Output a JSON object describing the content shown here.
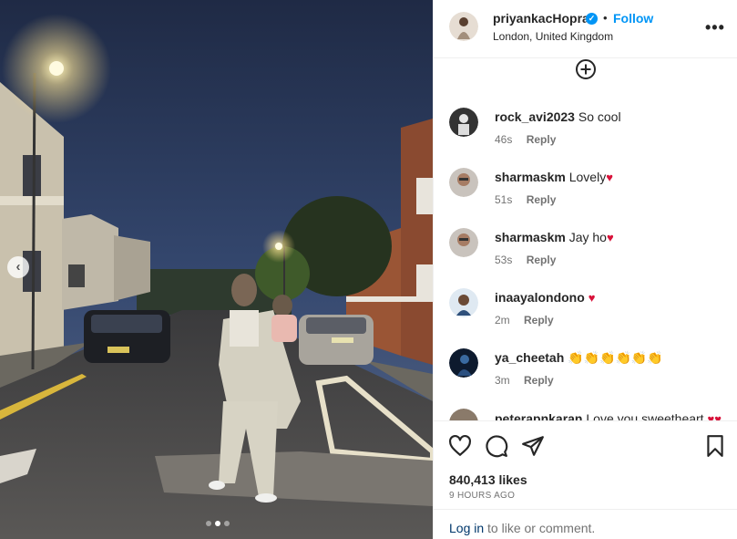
{
  "post": {
    "username": "priyankacHopra",
    "location": "London, United Kingdom",
    "follow_label": "Follow",
    "separator": "•",
    "more_label": "•••",
    "likes": "840,413 likes",
    "time_ago": "9 HOURS AGO",
    "carousel": {
      "prev_label": "‹"
    }
  },
  "comments": [
    {
      "user": "rock_avi2023",
      "text": "So cool",
      "heart": "",
      "time": "46s",
      "reply": "Reply"
    },
    {
      "user": "sharmaskm",
      "text": "Lovely",
      "heart": "♥",
      "time": "51s",
      "reply": "Reply"
    },
    {
      "user": "sharmaskm",
      "text": "Jay ho",
      "heart": "♥",
      "time": "53s",
      "reply": "Reply"
    },
    {
      "user": "inaayalondono",
      "text": "",
      "heart": "♥",
      "time": "2m",
      "reply": "Reply"
    },
    {
      "user": "ya_cheetah",
      "text": "👏👏👏👏👏👏",
      "heart": "",
      "time": "3m",
      "reply": "Reply"
    },
    {
      "user": "peterapnkaran",
      "text": "Love you sweetheart",
      "heart": "♥♥",
      "time": "",
      "reply": ""
    }
  ],
  "footer": {
    "login_link": "Log in",
    "login_suffix": " to like or comment."
  },
  "icons": {
    "verified": "verified-badge-icon",
    "add_comment": "plus-circle-icon",
    "like": "heart-icon",
    "comment": "comment-bubble-icon",
    "share": "paper-plane-icon",
    "save": "bookmark-icon"
  },
  "colors": {
    "accent": "#0095f6",
    "heart": "#d8123a",
    "muted": "#737373",
    "link": "#00376b"
  }
}
